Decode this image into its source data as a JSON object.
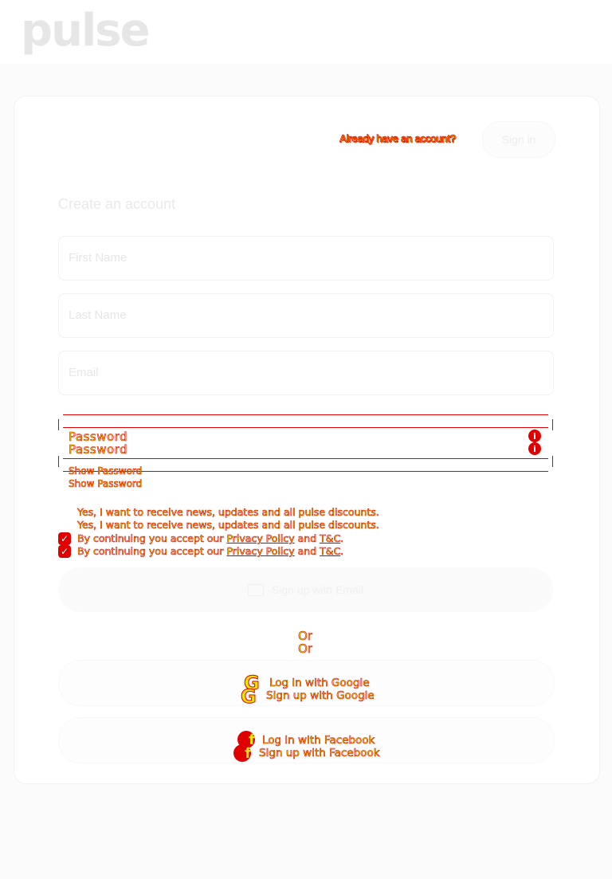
{
  "header": {
    "logo": "pulse"
  },
  "card": {
    "already_text": "Already have an account?",
    "signin_label": "Sign in",
    "title": "Create an account"
  },
  "form": {
    "first_name_placeholder": "First Name",
    "last_name_placeholder": "Last Name",
    "email_placeholder": "Email",
    "password_label": "Password",
    "show_password": "Show Password",
    "newsletter_text": "Yes, I want to receive news, updates and all pulse discounts.",
    "terms_prefix": "By continuing you accept our ",
    "privacy_link": "Privacy Policy",
    "terms_and": " and ",
    "tc_link": "T&C",
    "terms_suffix": ".",
    "email_signup_label": "Sign up with Email"
  },
  "divider": {
    "or": "Or"
  },
  "social": {
    "google_login": "Log in with Google",
    "google_signup": "Sign up with Google",
    "facebook_login": "Log in with Facebook",
    "facebook_signup": "Sign up with Facebook"
  },
  "colors": {
    "overlay_fill": "#f2e200",
    "overlay_stroke": "#e00000"
  },
  "icons": [
    "info-icon",
    "check-icon",
    "mail-icon",
    "google-icon",
    "facebook-icon"
  ]
}
